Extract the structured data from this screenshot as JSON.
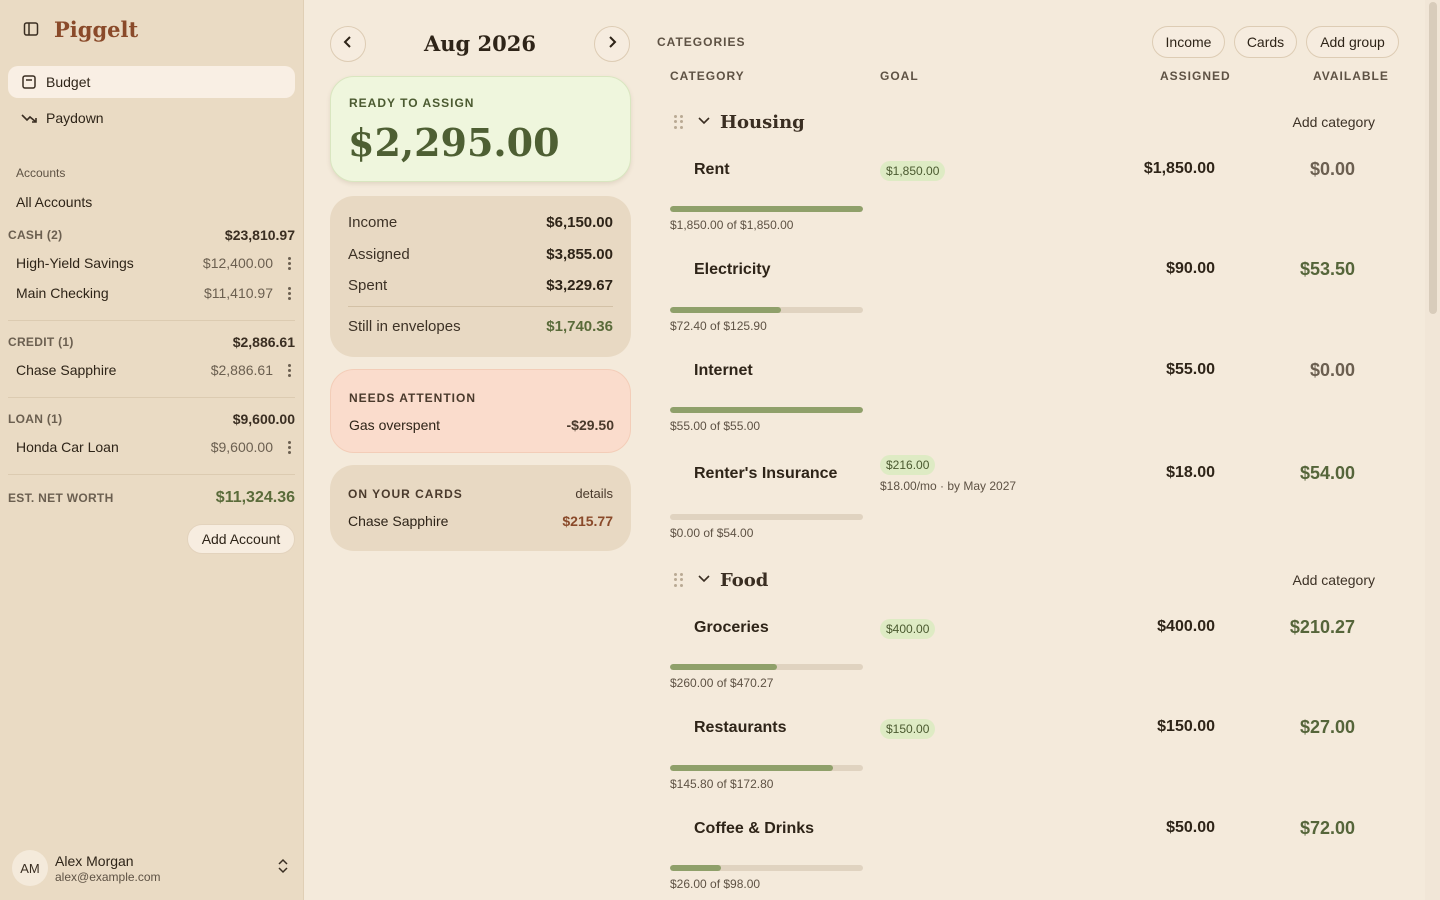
{
  "app": {
    "name": "Piggelt"
  },
  "nav": [
    {
      "label": "Budget",
      "icon": "budget-icon",
      "active": true
    },
    {
      "label": "Paydown",
      "icon": "trend-down-icon",
      "active": false
    }
  ],
  "accounts": {
    "heading": "Accounts",
    "all_label": "All Accounts",
    "groups": [
      {
        "name": "CASH (2)",
        "total": "$23,810.97",
        "items": [
          {
            "name": "High-Yield Savings",
            "balance": "$12,400.00"
          },
          {
            "name": "Main Checking",
            "balance": "$11,410.97"
          }
        ]
      },
      {
        "name": "CREDIT (1)",
        "total": "$2,886.61",
        "items": [
          {
            "name": "Chase Sapphire",
            "balance": "$2,886.61"
          }
        ]
      },
      {
        "name": "LOAN (1)",
        "total": "$9,600.00",
        "items": [
          {
            "name": "Honda Car Loan",
            "balance": "$9,600.00"
          }
        ]
      }
    ],
    "net_worth_label": "EST. NET WORTH",
    "net_worth": "$11,324.36",
    "add_label": "Add Account"
  },
  "user": {
    "initials": "AM",
    "name": "Alex Morgan",
    "email": "alex@example.com"
  },
  "month": "Aug 2026",
  "ready_to_assign": {
    "label": "READY TO ASSIGN",
    "amount": "$2,295.00"
  },
  "summary": {
    "income_label": "Income",
    "income": "$6,150.00",
    "assigned_label": "Assigned",
    "assigned": "$3,855.00",
    "spent_label": "Spent",
    "spent": "$3,229.67",
    "envelopes_label": "Still in envelopes",
    "envelopes": "$1,740.36"
  },
  "attention": {
    "label": "NEEDS ATTENTION",
    "item": "Gas overspent",
    "amount": "-$29.50"
  },
  "on_cards": {
    "label": "ON YOUR CARDS",
    "details": "details",
    "card": "Chase Sapphire",
    "amount": "$215.77"
  },
  "categories": {
    "title": "CATEGORIES",
    "buttons": {
      "income": "Income",
      "cards": "Cards",
      "add_group": "Add group"
    },
    "columns": {
      "category": "CATEGORY",
      "goal": "GOAL",
      "assigned": "ASSIGNED",
      "available": "AVAILABLE"
    },
    "add_category_label": "Add category",
    "groups": [
      {
        "name": "Housing",
        "rows": [
          {
            "name": "Rent",
            "goal": "$1,850.00",
            "goal_sub": "",
            "assigned": "$1,850.00",
            "available": "$0.00",
            "progress": 1.0,
            "progress_label": "$1,850.00 of $1,850.00"
          },
          {
            "name": "Electricity",
            "goal": "",
            "goal_sub": "",
            "assigned": "$90.00",
            "available": "$53.50",
            "progress": 0.577,
            "progress_label": "$72.40 of $125.90"
          },
          {
            "name": "Internet",
            "goal": "",
            "goal_sub": "",
            "assigned": "$55.00",
            "available": "$0.00",
            "progress": 1.0,
            "progress_label": "$55.00 of $55.00"
          },
          {
            "name": "Renter's Insurance",
            "goal": "$216.00",
            "goal_sub": "$18.00/mo · by May 2027",
            "assigned": "$18.00",
            "available": "$54.00",
            "progress": 0.0,
            "progress_label": "$0.00 of $54.00"
          }
        ]
      },
      {
        "name": "Food",
        "rows": [
          {
            "name": "Groceries",
            "goal": "$400.00",
            "goal_sub": "",
            "assigned": "$400.00",
            "available": "$210.27",
            "progress": 0.553,
            "progress_label": "$260.00 of $470.27"
          },
          {
            "name": "Restaurants",
            "goal": "$150.00",
            "goal_sub": "",
            "assigned": "$150.00",
            "available": "$27.00",
            "progress": 0.844,
            "progress_label": "$145.80 of $172.80"
          },
          {
            "name": "Coffee & Drinks",
            "goal": "",
            "goal_sub": "",
            "assigned": "$50.00",
            "available": "$72.00",
            "progress": 0.265,
            "progress_label": "$26.00 of $98.00"
          }
        ]
      }
    ]
  },
  "colors": {
    "accent": "#8a4a2a",
    "positive": "#55653a",
    "bar": "#8fa06a",
    "attention": "#fadccc",
    "ready": "#eff6dd"
  }
}
